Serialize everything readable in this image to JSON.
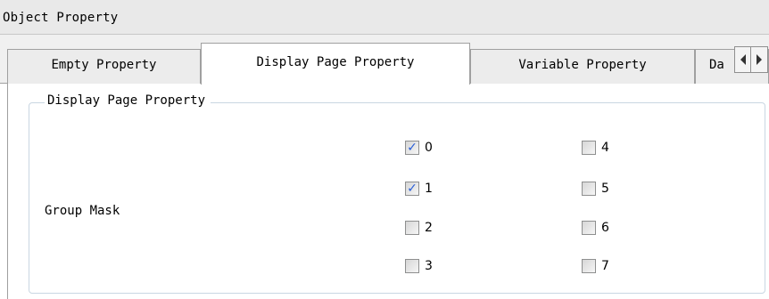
{
  "window": {
    "title": "Object Property"
  },
  "tabs": [
    {
      "label": "Empty Property",
      "active": false
    },
    {
      "label": "Display Page Property",
      "active": true
    },
    {
      "label": "Variable Property",
      "active": false
    },
    {
      "label": "Da",
      "active": false
    }
  ],
  "group": {
    "legend": "Display Page Property",
    "field_label": "Group Mask",
    "checkboxes": [
      {
        "label": "0",
        "checked": true
      },
      {
        "label": "1",
        "checked": true
      },
      {
        "label": "2",
        "checked": false
      },
      {
        "label": "3",
        "checked": false
      },
      {
        "label": "4",
        "checked": false
      },
      {
        "label": "5",
        "checked": false
      },
      {
        "label": "6",
        "checked": false
      },
      {
        "label": "7",
        "checked": false
      }
    ]
  },
  "icons": {
    "scroll_left": "arrow-left-icon",
    "scroll_right": "arrow-right-icon"
  },
  "colors": {
    "check": "#2a5fd8",
    "groupbox_border": "#c9d6e2"
  }
}
